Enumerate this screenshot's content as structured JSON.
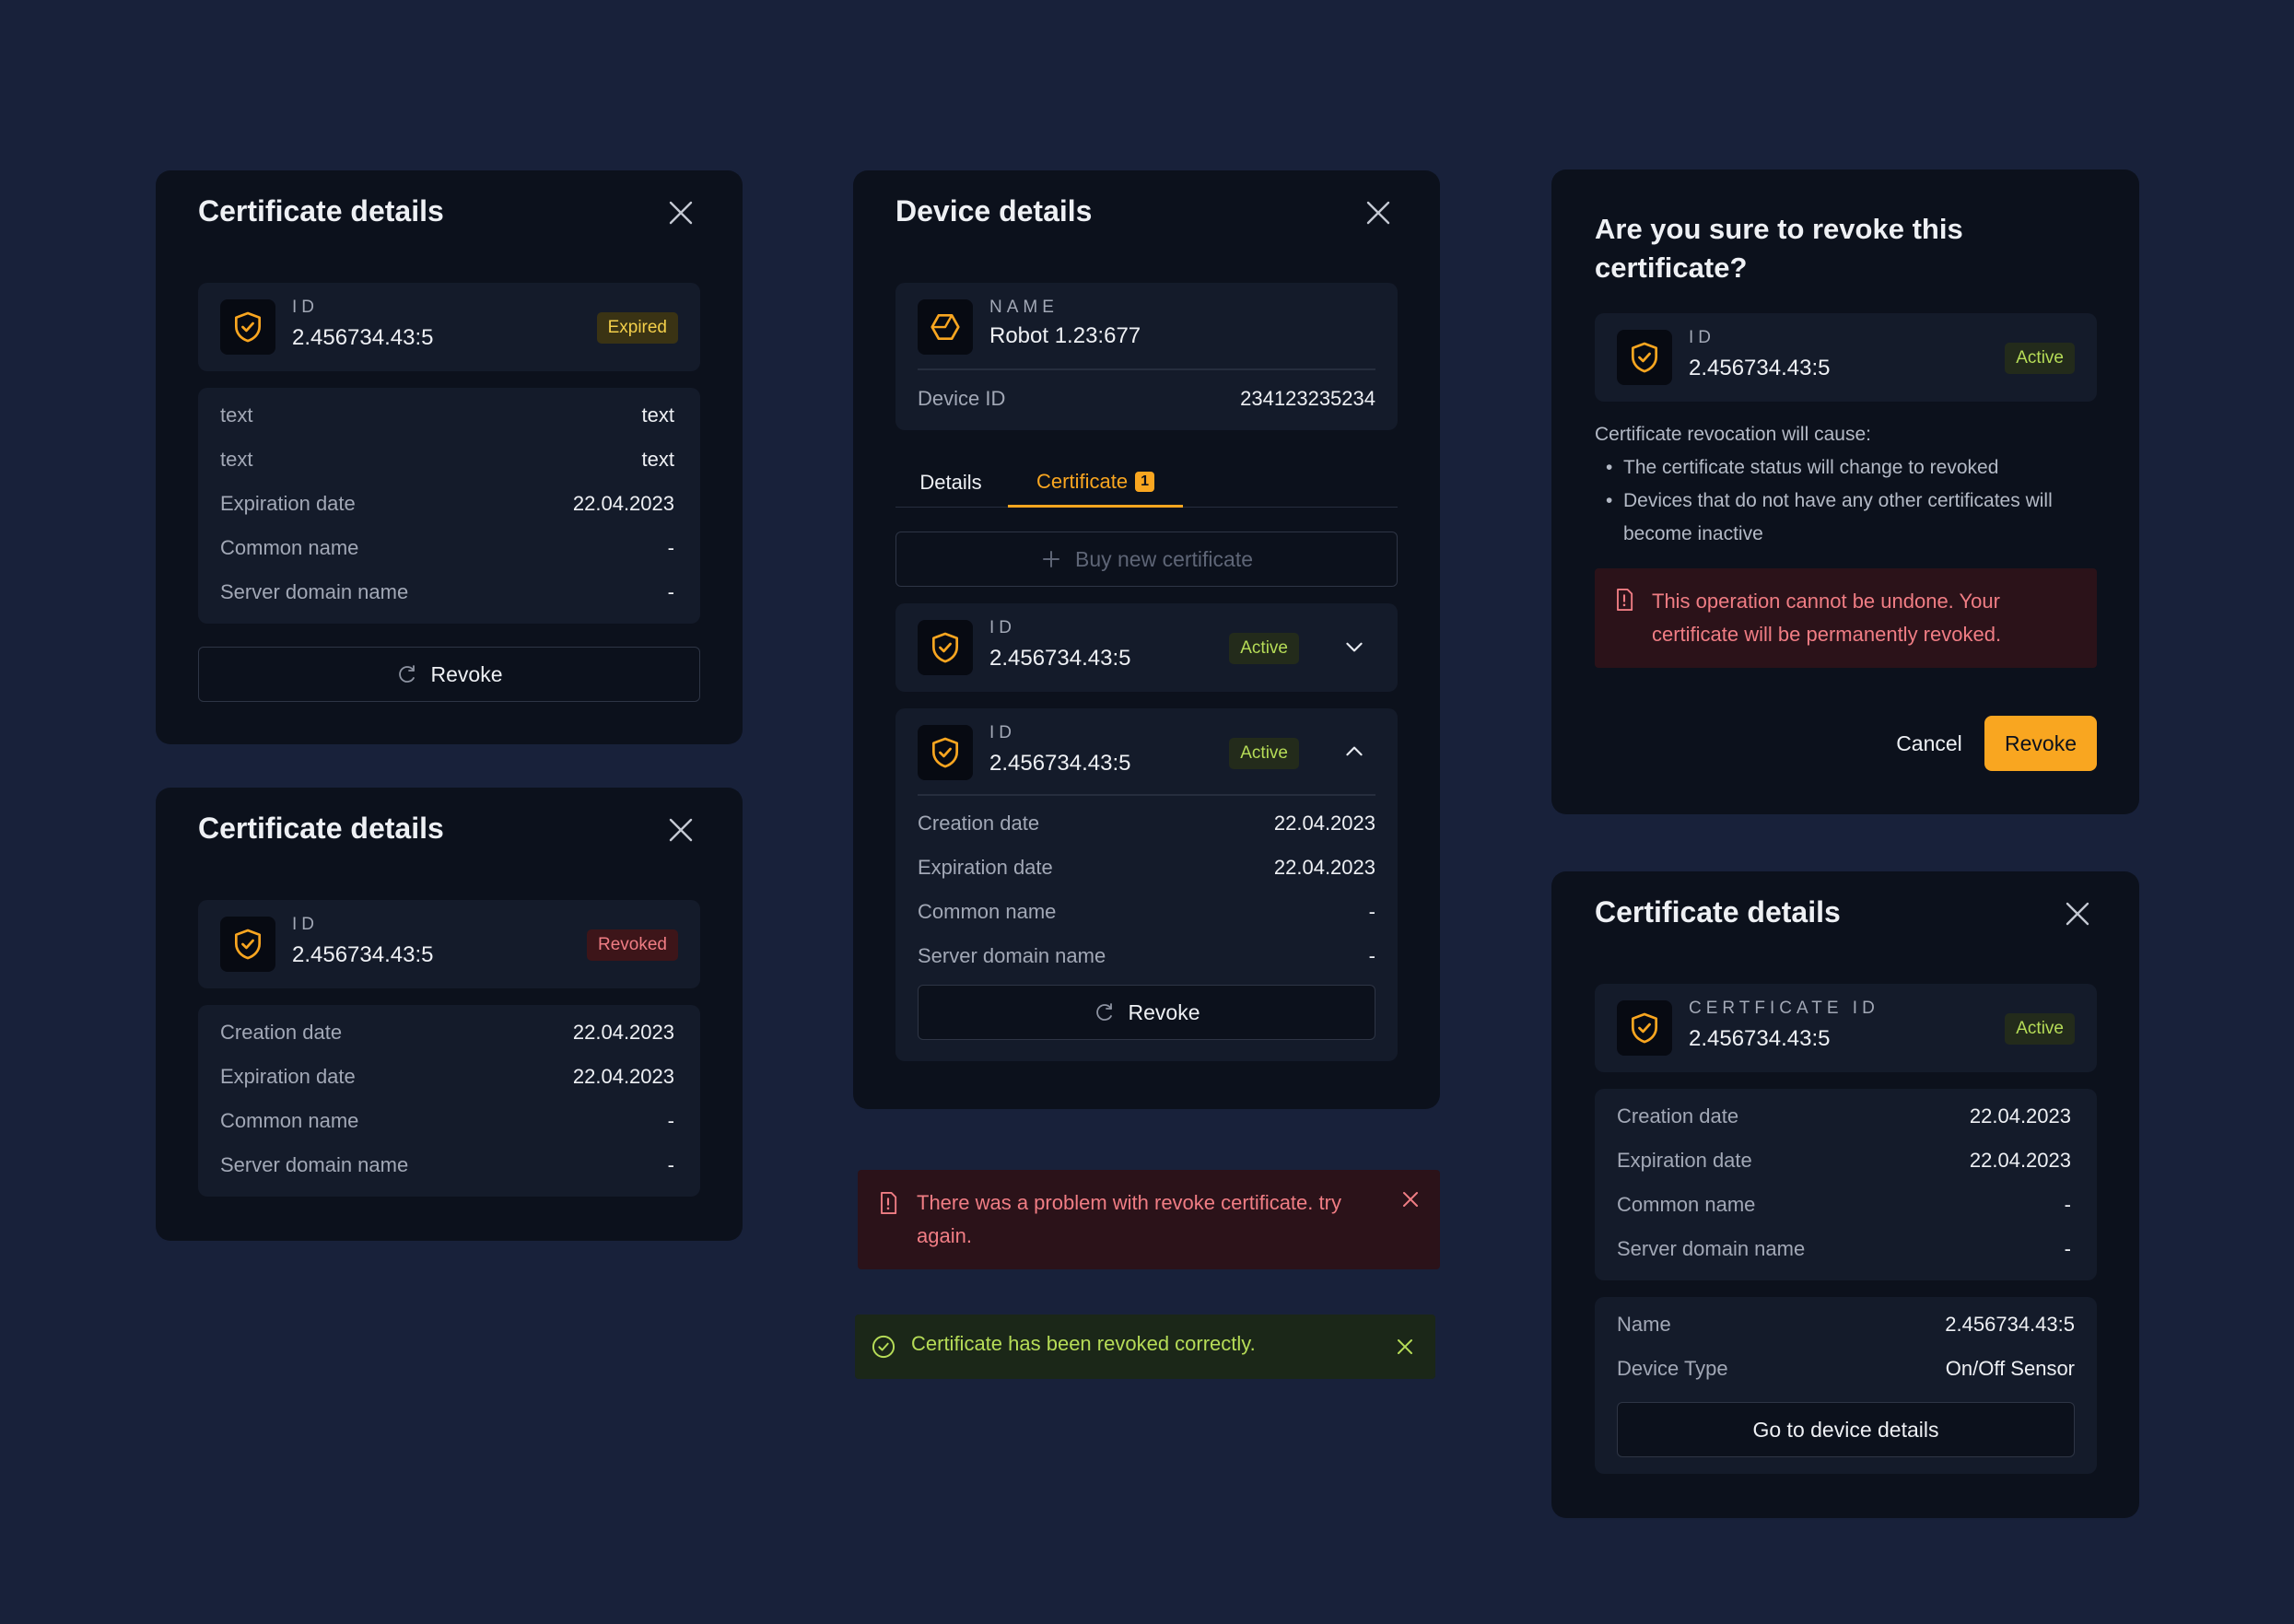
{
  "colors": {
    "accent": "#f9a620",
    "success": "#b6dc57",
    "danger": "#f07d84",
    "background": "#18213a",
    "panel": "#0c111c"
  },
  "cert_expired": {
    "title": "Certificate details",
    "id_label": "ID",
    "id_value": "2.456734.43:5",
    "status": "Expired",
    "rows": [
      {
        "k": "text",
        "v": "text"
      },
      {
        "k": "text",
        "v": "text"
      },
      {
        "k": "Expiration date",
        "v": "22.04.2023"
      },
      {
        "k": "Common name",
        "v": "-"
      },
      {
        "k": "Server domain name",
        "v": "-"
      }
    ],
    "revoke_label": "Revoke"
  },
  "cert_revoked": {
    "title": "Certificate details",
    "id_label": "ID",
    "id_value": "2.456734.43:5",
    "status": "Revoked",
    "rows": [
      {
        "k": "Creation date",
        "v": "22.04.2023"
      },
      {
        "k": "Expiration date",
        "v": "22.04.2023"
      },
      {
        "k": "Common name",
        "v": "-"
      },
      {
        "k": "Server domain name",
        "v": "-"
      }
    ]
  },
  "device": {
    "title": "Device details",
    "name_label": "NAME",
    "name_value": "Robot 1.23:677",
    "device_id_label": "Device ID",
    "device_id_value": "234123235234",
    "tabs": [
      {
        "label": "Details"
      },
      {
        "label": "Certificate",
        "count": "1"
      }
    ],
    "buy_label": "Buy new certificate",
    "cert1": {
      "id_label": "ID",
      "id_value": "2.456734.43:5",
      "status": "Active"
    },
    "cert2": {
      "id_label": "ID",
      "id_value": "2.456734.43:5",
      "status": "Active",
      "rows": [
        {
          "k": "Creation date",
          "v": "22.04.2023"
        },
        {
          "k": "Expiration date",
          "v": "22.04.2023"
        },
        {
          "k": "Common name",
          "v": "-"
        },
        {
          "k": "Server domain name",
          "v": "-"
        }
      ],
      "revoke_label": "Revoke"
    }
  },
  "toast_error": {
    "message": "There was a problem with revoke certificate. try again."
  },
  "toast_success": {
    "message": "Certificate has been revoked correctly."
  },
  "confirm": {
    "title": "Are you sure to revoke this certificate?",
    "id_label": "ID",
    "id_value": "2.456734.43:5",
    "status": "Active",
    "cause_intro": "Certificate revocation will cause:",
    "bullets": [
      "The certificate status will change to revoked",
      "Devices that do not have any other certificates will become inactive"
    ],
    "warning": "This operation cannot be undone. Your certificate will be permanently revoked.",
    "cancel_label": "Cancel",
    "revoke_label": "Revoke"
  },
  "cert_active": {
    "title": "Certificate details",
    "id_label": "CERTFICATE ID",
    "id_value": "2.456734.43:5",
    "status": "Active",
    "rows": [
      {
        "k": "Creation date",
        "v": "22.04.2023"
      },
      {
        "k": "Expiration date",
        "v": "22.04.2023"
      },
      {
        "k": "Common name",
        "v": "-"
      },
      {
        "k": "Server domain name",
        "v": "-"
      }
    ],
    "device_rows": [
      {
        "k": "Name",
        "v": "2.456734.43:5"
      },
      {
        "k": "Device Type",
        "v": "On/Off Sensor"
      }
    ],
    "goto_label": "Go to device details"
  }
}
